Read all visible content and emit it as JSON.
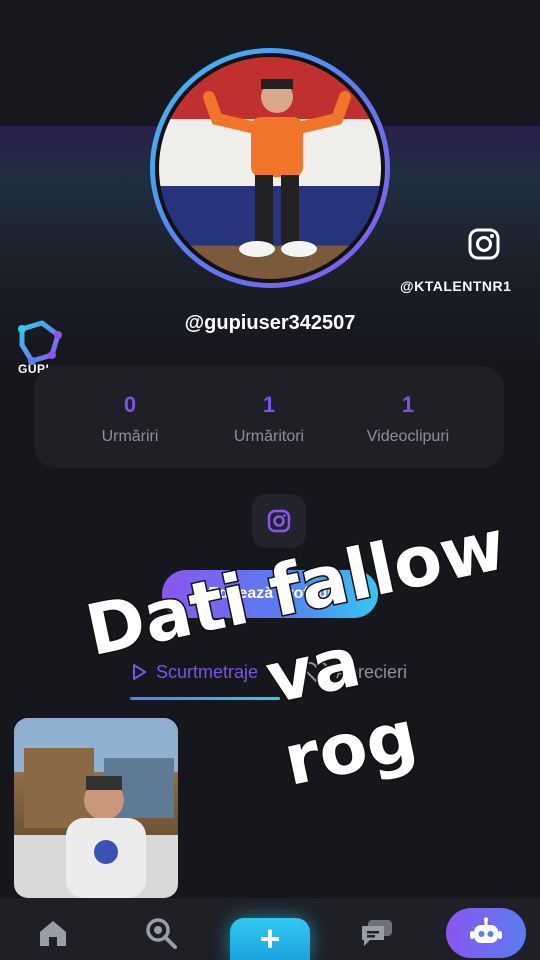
{
  "profile": {
    "username": "@gupiuser342507",
    "instagram_handle": "@KTALENTNR1",
    "avatar_desc": "profile-photo"
  },
  "brand": {
    "name": "GUPI",
    "accent_purple": "#7d52e8",
    "accent_cyan": "#33c8f0"
  },
  "stats": [
    {
      "value": "0",
      "label": "Urmăriri"
    },
    {
      "value": "1",
      "label": "Urmăritori"
    },
    {
      "value": "1",
      "label": "Videoclipuri"
    }
  ],
  "actions": {
    "edit_profile": "Editează profilul"
  },
  "tabs": {
    "videos": "Scurtmetraje",
    "likes": "Aprecieri"
  },
  "overlay": {
    "line1": "Dati fallow va",
    "line2": "rog"
  },
  "nav": {
    "items": [
      "home-icon",
      "discover-icon",
      "add-icon",
      "messages-icon",
      "bot-icon"
    ],
    "add_symbol": "+"
  }
}
